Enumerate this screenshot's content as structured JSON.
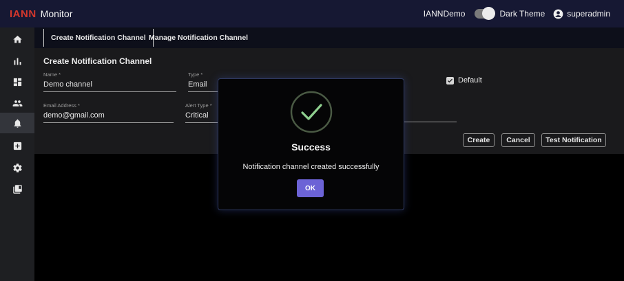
{
  "header": {
    "brand": "IANN",
    "title": "Monitor",
    "instance": "IANNDemo",
    "theme_label": "Dark Theme",
    "theme_on": true,
    "user": "superadmin"
  },
  "sidebar": {
    "items": [
      {
        "icon": "home-icon"
      },
      {
        "icon": "bar-chart-icon"
      },
      {
        "icon": "dashboard-icon"
      },
      {
        "icon": "people-icon"
      },
      {
        "icon": "bell-icon",
        "active": true
      },
      {
        "icon": "add-box-icon"
      },
      {
        "icon": "gear-icon"
      },
      {
        "icon": "library-icon"
      }
    ]
  },
  "tabs": [
    {
      "label": "Create Notification Channel",
      "active": true
    },
    {
      "label": "Manage Notification Channel",
      "active": false
    }
  ],
  "form": {
    "title": "Create Notification Channel",
    "name_label": "Name *",
    "name_value": "Demo channel",
    "type_label": "Type *",
    "type_value": "Email",
    "email_label": "Email Address *",
    "email_value": "demo@gmail.com",
    "alert_type_label": "Alert Type *",
    "alert_type_value": "Critical",
    "default_label": "Default",
    "default_checked": true,
    "create_label": "Create",
    "cancel_label": "Cancel",
    "test_label": "Test Notification"
  },
  "dialog": {
    "title": "Success",
    "message": "Notification channel created successfully",
    "ok_label": "OK"
  },
  "colors": {
    "topbar": "#161833",
    "brand": "#d2372c",
    "accent_button": "#6c63d6",
    "success_check": "#8fd08f"
  }
}
